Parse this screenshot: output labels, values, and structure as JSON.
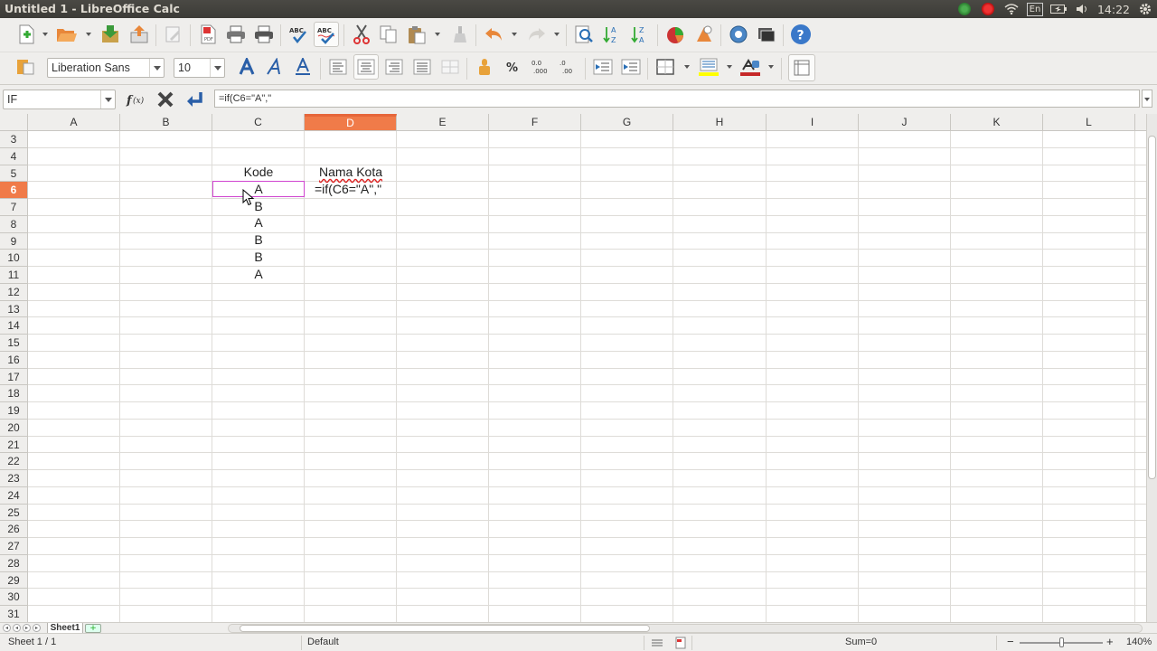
{
  "window": {
    "title": "Untitled 1 - LibreOffice Calc"
  },
  "tray": {
    "keyboard": "En",
    "clock": "14:22"
  },
  "toolbar": {
    "font_name": "Liberation Sans",
    "font_size": "10"
  },
  "formula_bar": {
    "name_box": "IF",
    "content": "=if(C6=\"A\",\""
  },
  "columns": [
    "A",
    "B",
    "C",
    "D",
    "E",
    "F",
    "G",
    "H",
    "I",
    "J",
    "K",
    "L"
  ],
  "rows": [
    "3",
    "4",
    "5",
    "6",
    "7",
    "8",
    "9",
    "10",
    "11",
    "12",
    "13",
    "14",
    "15",
    "16",
    "17",
    "18",
    "19",
    "20",
    "21",
    "22",
    "23",
    "24",
    "25",
    "26",
    "27",
    "28",
    "29",
    "30",
    "31"
  ],
  "cells": {
    "C5": "Kode",
    "D5": "Nama Kota",
    "C6": "A",
    "D6": "=if(C6=\"A\",\"",
    "C7": "B",
    "C8": "A",
    "C9": "B",
    "C10": "B",
    "C11": "A"
  },
  "sheet_tabs": {
    "active": "Sheet1"
  },
  "status": {
    "sheet": "Sheet 1 / 1",
    "style": "Default",
    "sum": "Sum=0",
    "zoom": "140%"
  },
  "colors": {
    "selection": "#f07b49",
    "cell_cursor": "#d046d0"
  }
}
